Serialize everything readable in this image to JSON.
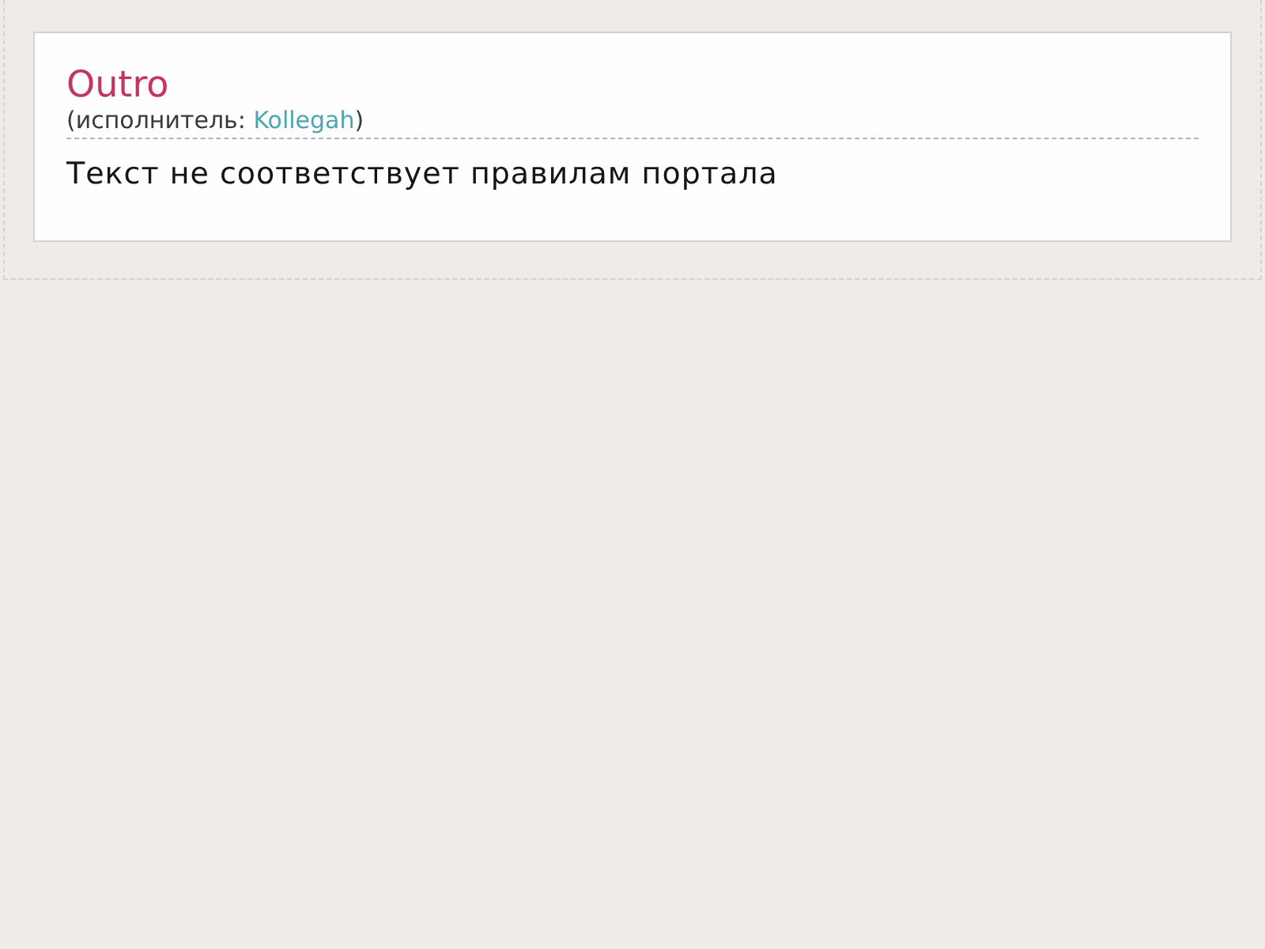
{
  "song": {
    "title": "Outro",
    "credit": {
      "prefix": "(исполнитель: ",
      "artist": "Kollegah",
      "suffix": ")"
    }
  },
  "message": "Текст не соответствует правилам портала"
}
